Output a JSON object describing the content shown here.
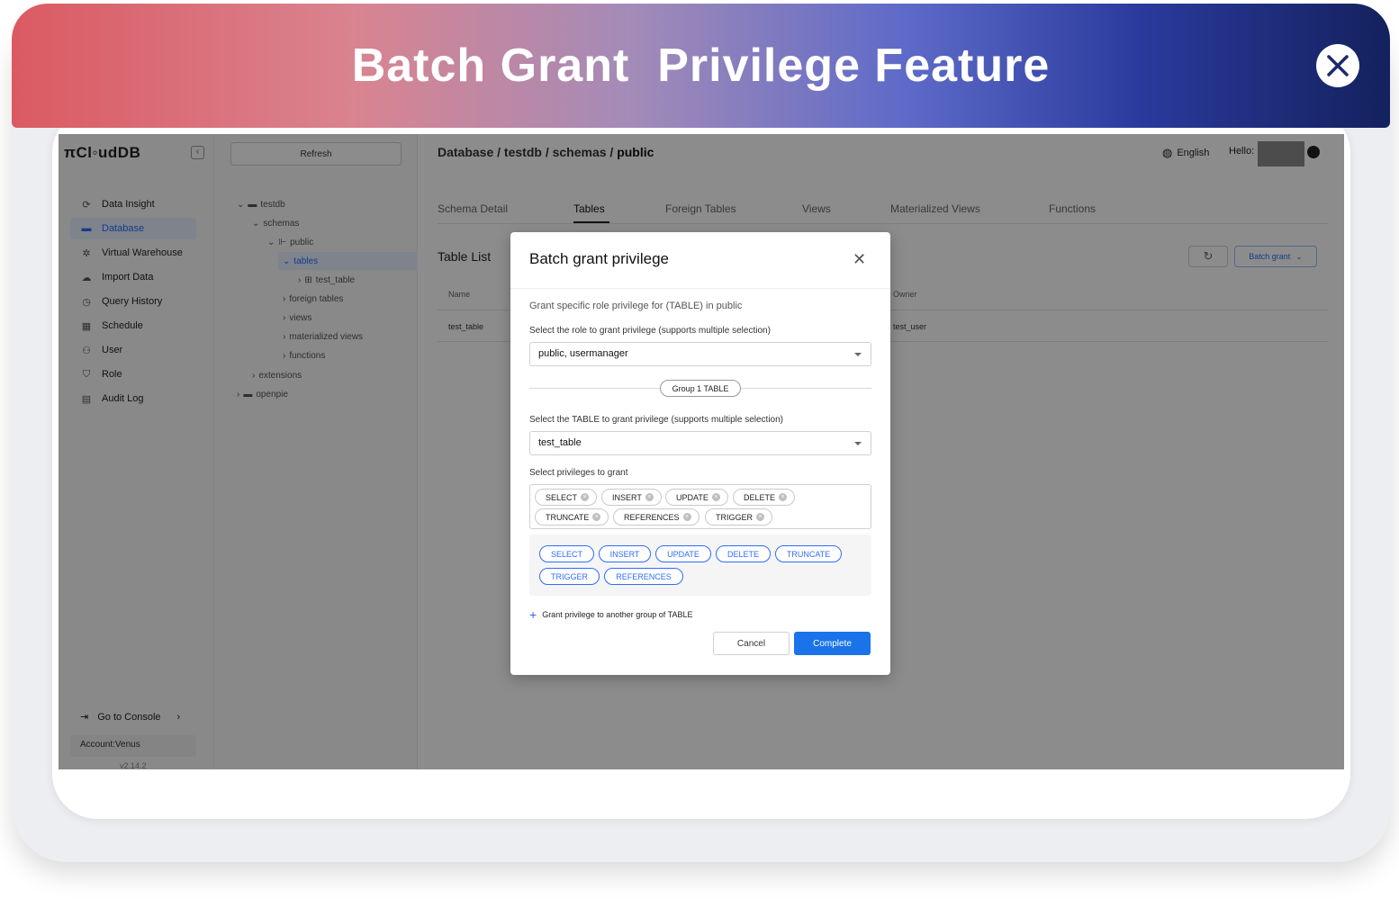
{
  "banner": {
    "title": "Batch Grant  Privilege Feature"
  },
  "app": {
    "logo": "πCl◦udDB",
    "sidebar": {
      "items": [
        {
          "label": "Data Insight",
          "icon": "data-insight-icon"
        },
        {
          "label": "Database",
          "icon": "database-icon",
          "active": true
        },
        {
          "label": "Virtual Warehouse",
          "icon": "warehouse-icon"
        },
        {
          "label": "Import Data",
          "icon": "cloud-upload-icon"
        },
        {
          "label": "Query History",
          "icon": "history-icon"
        },
        {
          "label": "Schedule",
          "icon": "calendar-icon"
        },
        {
          "label": "User",
          "icon": "users-icon"
        },
        {
          "label": "Role",
          "icon": "shield-icon"
        },
        {
          "label": "Audit Log",
          "icon": "log-icon"
        }
      ],
      "console": "Go to Console",
      "account": "Account:Venus",
      "version": "v2.14.2"
    },
    "tree": {
      "refresh": "Refresh",
      "nodes": [
        "testdb",
        "schemas",
        "public",
        "tables",
        "test_table",
        "foreign tables",
        "views",
        "materialized views",
        "functions",
        "extensions",
        "openpie"
      ]
    },
    "header": {
      "breadcrumb_prefix": "Database / testdb / schemas / ",
      "breadcrumb_current": "public",
      "language": "English",
      "hello": "Hello:"
    },
    "tabs": [
      "Schema Detail",
      "Tables",
      "Foreign Tables",
      "Views",
      "Materialized Views",
      "Functions"
    ],
    "table_list": {
      "title": "Table List",
      "batch_grant": "Batch grant",
      "columns": [
        "Name",
        "Owner"
      ],
      "rows": [
        {
          "name": "test_table",
          "owner": "test_user"
        }
      ]
    }
  },
  "modal": {
    "title": "Batch grant privilege",
    "description": "Grant specific role privilege for (TABLE) in public",
    "role_label": "Select the role to grant privilege (supports multiple selection)",
    "role_value": "public, usermanager",
    "group_label": "Group 1 TABLE",
    "table_label": "Select the TABLE to grant privilege (supports multiple selection)",
    "table_value": "test_table",
    "privileges_label": "Select privileges to grant",
    "selected_privileges": [
      "SELECT",
      "INSERT",
      "UPDATE",
      "DELETE",
      "TRUNCATE",
      "REFERENCES",
      "TRIGGER"
    ],
    "options": [
      "SELECT",
      "INSERT",
      "UPDATE",
      "DELETE",
      "TRUNCATE",
      "TRIGGER",
      "REFERENCES"
    ],
    "add_group": "Grant privilege to another group of TABLE",
    "cancel": "Cancel",
    "complete": "Complete"
  },
  "colors": {
    "accent": "#1a73e8",
    "banner_start": "#db5a62",
    "banner_end": "#14215e"
  }
}
